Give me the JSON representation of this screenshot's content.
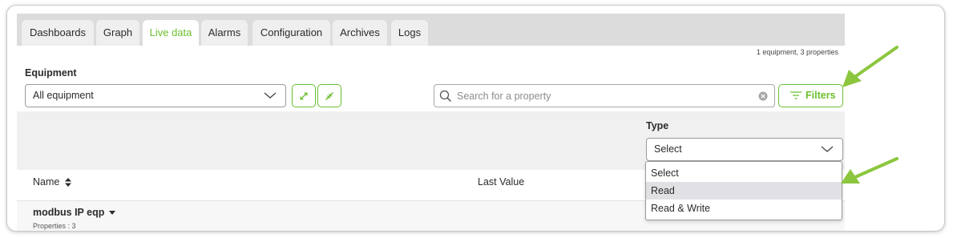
{
  "tabs": [
    {
      "label": "Dashboards",
      "active": false
    },
    {
      "label": "Graph",
      "active": false
    },
    {
      "label": "Live data",
      "active": true
    },
    {
      "label": "Alarms",
      "active": false
    },
    {
      "label": "Configuration",
      "active": false
    },
    {
      "label": "Archives",
      "active": false
    },
    {
      "label": "Logs",
      "active": false
    }
  ],
  "summary": "1 equipment, 3 properties",
  "equipment": {
    "label": "Equipment",
    "selected": "All equipment"
  },
  "search": {
    "placeholder": "Search for a property"
  },
  "filters": {
    "label": "Filters"
  },
  "type_filter": {
    "label": "Type",
    "selected": "Select",
    "options": [
      "Select",
      "Read",
      "Read & Write"
    ],
    "highlighted": "Read"
  },
  "table": {
    "columns": [
      "Name",
      "Last Value"
    ],
    "rows": [
      {
        "name": "modbus IP eqp",
        "properties": "Properties : 3"
      }
    ]
  },
  "colors": {
    "accent": "#6bbf2e",
    "arrow": "#8cc63f",
    "tabbar": "#dcdcdc",
    "filter_panel": "#f0f0f0",
    "highlight": "#e1e1e5"
  },
  "icons": [
    "expand-icon",
    "collapse-icon",
    "search-icon",
    "clear-icon",
    "filter-icon",
    "chevron-down-icon",
    "sort-icon",
    "caret-down-icon",
    "arrow-icon"
  ]
}
